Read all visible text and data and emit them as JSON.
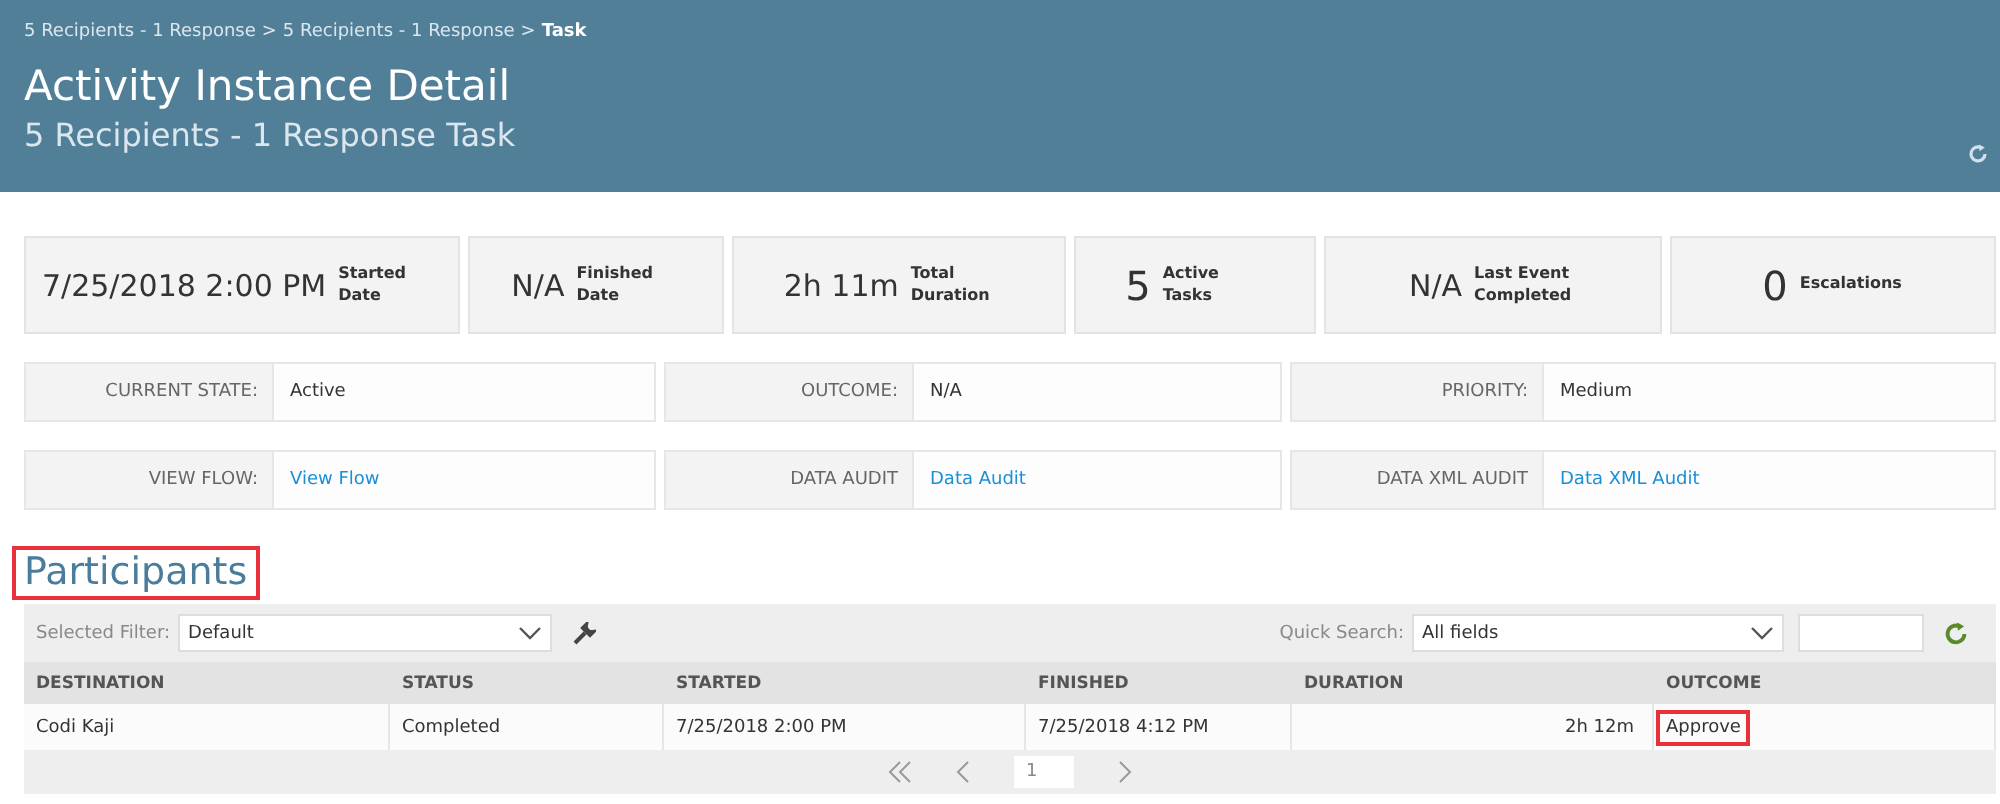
{
  "header": {
    "breadcrumb": [
      {
        "label": "5 Recipients - 1 Response",
        "current": false
      },
      {
        "label": "5 Recipients - 1 Response",
        "current": false
      },
      {
        "label": "Task",
        "current": true
      }
    ],
    "separator": ">",
    "title": "Activity Instance Detail",
    "subtitle": "5 Recipients - 1 Response Task"
  },
  "stats": [
    {
      "value": "7/25/2018 2:00 PM",
      "label": "Started Date"
    },
    {
      "value": "N/A",
      "label": "Finished Date"
    },
    {
      "value": "2h 11m",
      "label": "Total Duration"
    },
    {
      "value": "5",
      "label": "Active Tasks"
    },
    {
      "value": "N/A",
      "label": "Last Event Completed"
    },
    {
      "value": "0",
      "label": "Escalations"
    }
  ],
  "info_rows": [
    [
      {
        "label": "CURRENT STATE:",
        "value": "Active",
        "kind": "text"
      },
      {
        "label": "OUTCOME:",
        "value": "N/A",
        "kind": "text"
      },
      {
        "label": "PRIORITY:",
        "value": "Medium",
        "kind": "text"
      }
    ],
    [
      {
        "label": "VIEW FLOW:",
        "value": "View Flow",
        "kind": "link"
      },
      {
        "label": "DATA AUDIT",
        "value": "Data Audit",
        "kind": "link"
      },
      {
        "label": "DATA XML AUDIT",
        "value": "Data XML Audit",
        "kind": "link"
      }
    ]
  ],
  "participants": {
    "title": "Participants",
    "highlighted": true,
    "filter": {
      "label": "Selected Filter:",
      "value": "Default"
    },
    "quick_search": {
      "label": "Quick Search:",
      "value": "All fields"
    },
    "columns": [
      "DESTINATION",
      "STATUS",
      "STARTED",
      "FINISHED",
      "DURATION",
      "OUTCOME"
    ],
    "rows": [
      [
        {
          "text": "Codi Kaji",
          "highlighted": false
        },
        {
          "text": "Completed",
          "highlighted": false
        },
        {
          "text": "7/25/2018 2:00 PM",
          "highlighted": false
        },
        {
          "text": "7/25/2018 4:12 PM",
          "highlighted": false
        },
        {
          "text": "2h 12m",
          "highlighted": false
        },
        {
          "text": "Approve",
          "highlighted": true
        }
      ]
    ],
    "page": "1"
  }
}
